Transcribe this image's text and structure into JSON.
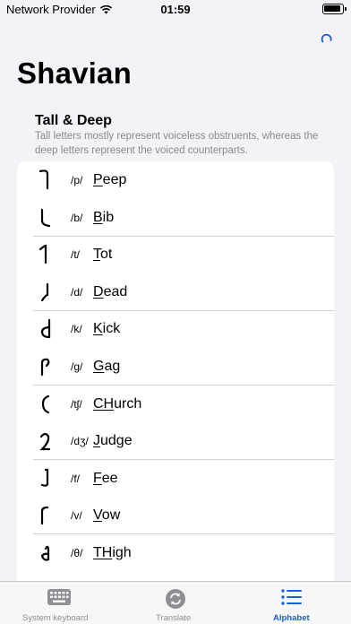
{
  "status": {
    "carrier": "Network Provider",
    "time": "01:59"
  },
  "header": {
    "title": "Shavian"
  },
  "section": {
    "title": "Tall & Deep",
    "description": "Tall letters mostly represent voiceless obstruents, whereas the deep letters represent the voiced counterparts."
  },
  "letters": [
    {
      "ipa": "/p/",
      "underlined": "P",
      "rest": "eep",
      "glyph": "peep"
    },
    {
      "ipa": "/b/",
      "underlined": "B",
      "rest": "ib",
      "glyph": "bib"
    },
    {
      "ipa": "/t/",
      "underlined": "T",
      "rest": "ot",
      "glyph": "tot"
    },
    {
      "ipa": "/d/",
      "underlined": "D",
      "rest": "ead",
      "glyph": "dead"
    },
    {
      "ipa": "/k/",
      "underlined": "K",
      "rest": "ick",
      "glyph": "kick"
    },
    {
      "ipa": "/g/",
      "underlined": "G",
      "rest": "ag",
      "glyph": "gag"
    },
    {
      "ipa": "/tʃ/",
      "underlined": "CH",
      "rest": "urch",
      "glyph": "church"
    },
    {
      "ipa": "/dʒ/",
      "underlined": "J",
      "rest": "udge",
      "glyph": "judge"
    },
    {
      "ipa": "/f/",
      "underlined": "F",
      "rest": "ee",
      "glyph": "fee"
    },
    {
      "ipa": "/v/",
      "underlined": "V",
      "rest": "ow",
      "glyph": "vow"
    },
    {
      "ipa": "/θ/",
      "underlined": "TH",
      "rest": "igh",
      "glyph": "thigh"
    }
  ],
  "tabs": [
    {
      "label": "System keyboard",
      "icon": "keyboard-icon",
      "active": false
    },
    {
      "label": "Translate",
      "icon": "translate-icon",
      "active": false
    },
    {
      "label": "Alphabet",
      "icon": "list-icon",
      "active": true
    }
  ],
  "colors": {
    "accent": "#1d5fd6",
    "background": "#f2f2f7",
    "secondary_text": "#8a8a8e"
  }
}
